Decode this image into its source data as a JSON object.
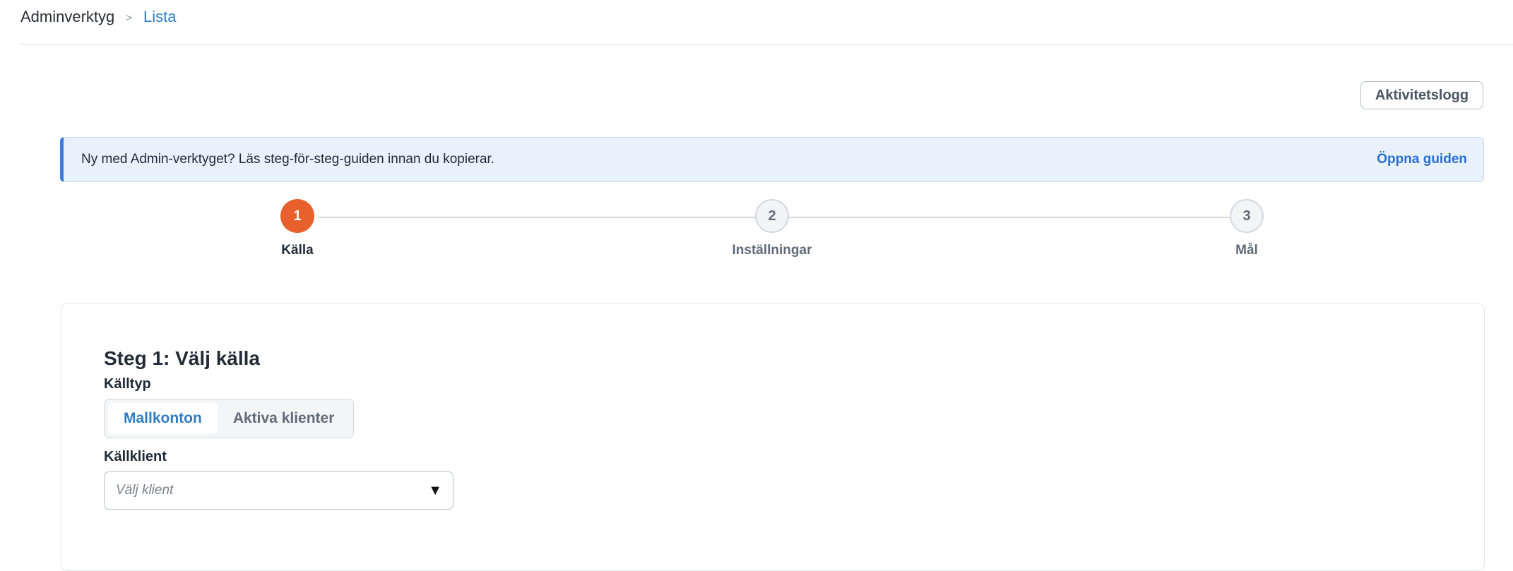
{
  "breadcrumb": {
    "root": "Adminverktyg",
    "separator": ">",
    "current": "Lista"
  },
  "header": {
    "activity_log_label": "Aktivitetslogg"
  },
  "banner": {
    "text": "Ny med Admin-verktyget? Läs steg-för-steg-guiden innan du kopierar.",
    "link_label": "Öppna guiden"
  },
  "stepper": {
    "steps": [
      {
        "number": "1",
        "label": "Källa",
        "state": "active"
      },
      {
        "number": "2",
        "label": "Inställningar",
        "state": "inactive"
      },
      {
        "number": "3",
        "label": "Mål",
        "state": "inactive"
      }
    ]
  },
  "step1": {
    "title": "Steg 1: Välj källa",
    "source_type_label": "Källtyp",
    "source_type_options": [
      {
        "label": "Mallkonton",
        "selected": true
      },
      {
        "label": "Aktiva klienter",
        "selected": false
      }
    ],
    "source_client_label": "Källklient",
    "source_client_placeholder": "Välj klient",
    "source_client_arrow": "▼"
  },
  "colors": {
    "accent_orange": "#e8602c",
    "link_blue": "#2f7cc4",
    "banner_border": "#3b7dd8",
    "banner_bg": "#e9f1fc"
  },
  "icons": {
    "dropdown": "chevron-down-icon"
  }
}
